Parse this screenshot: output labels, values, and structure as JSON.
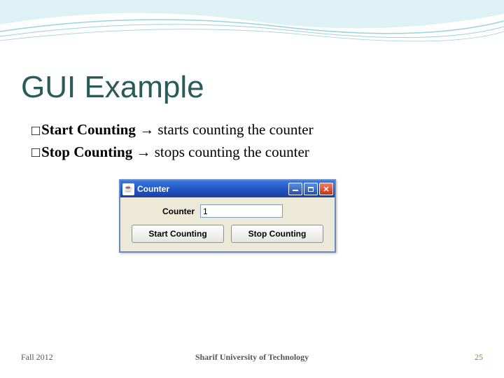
{
  "slide": {
    "title": "GUI Example",
    "bullets": {
      "line1_bold": "Start Counting",
      "line1_rest": " starts counting the counter",
      "line2_bold": "Stop Counting",
      "line2_rest": " stops counting the counter",
      "arrow": "→"
    }
  },
  "window": {
    "title": "Counter",
    "counter_label": "Counter",
    "counter_value": "1",
    "buttons": {
      "start": "Start Counting",
      "stop": "Stop Counting"
    },
    "close_glyph": "✕",
    "java_glyph": "☕"
  },
  "footer": {
    "left": "Fall 2012",
    "center": "Sharif University of Technology",
    "page": "25"
  }
}
